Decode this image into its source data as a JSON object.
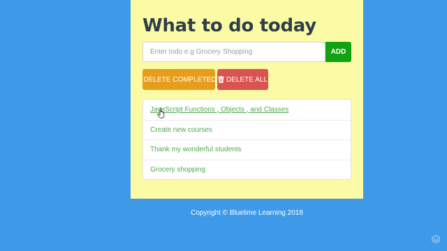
{
  "app": {
    "title": "What to do today"
  },
  "form": {
    "placeholder": "Enter todo e.g Grocery Shopping",
    "value": "",
    "add_label": "ADD"
  },
  "actions": {
    "delete_completed_label": "DELETE COMPLETED",
    "delete_all_label": "DELETE ALL",
    "icon": "trash-icon"
  },
  "todos": [
    {
      "label": "JavaScript Functions , Objects , and Classes",
      "hovered": true
    },
    {
      "label": "Create new courses"
    },
    {
      "label": "Thank my wonderful students"
    },
    {
      "label": "Grocery shopping"
    }
  ],
  "footer": {
    "text": "Copyright © Bluelime Learning 2018"
  },
  "colors": {
    "background": "#3e9ae8",
    "panel": "#fbfba5",
    "add_button": "#12a312",
    "delete_completed": "#e69d1c",
    "delete_all": "#d9534f",
    "todo_text": "#4da94d",
    "title": "#2f3d4a"
  }
}
